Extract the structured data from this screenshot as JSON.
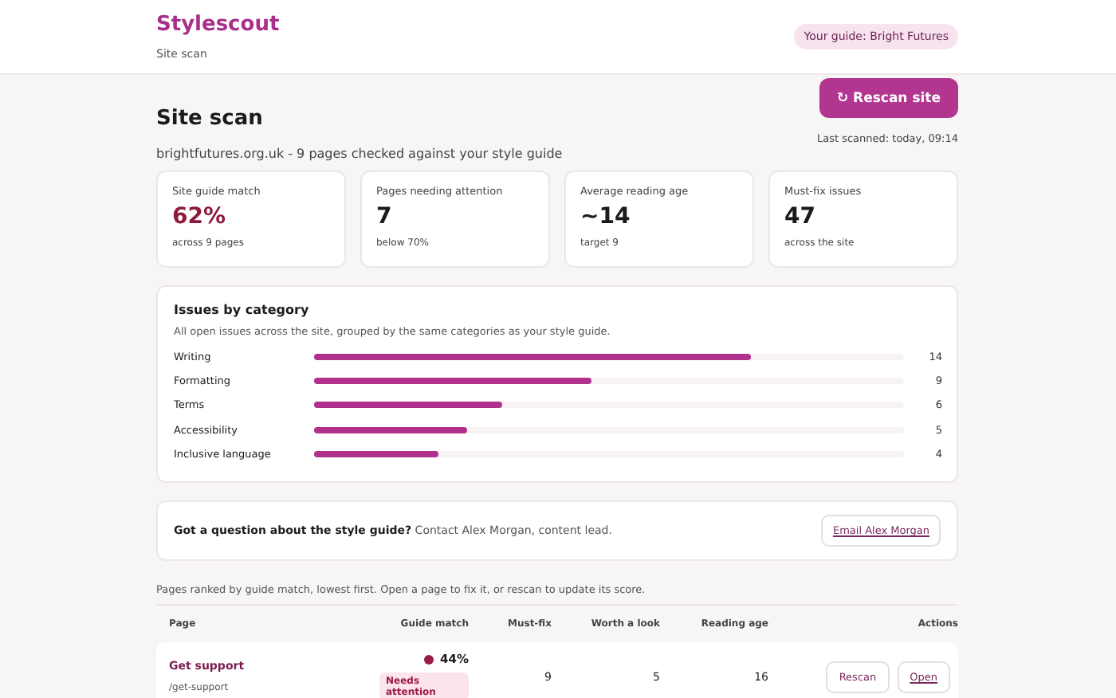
{
  "app": {
    "name": "Stylescout",
    "subtitle": "Site scan",
    "guide_badge": "Your guide: Bright Futures"
  },
  "page": {
    "title": "Site scan",
    "description": "brightfutures.org.uk - 9 pages checked against your style guide",
    "rescan_button": "↻ Rescan site",
    "last_scanned": "Last scanned: today, 09:14"
  },
  "stats": [
    {
      "label": "Site guide match",
      "value": "62%",
      "note": "across 9 pages",
      "kind": "alert"
    },
    {
      "label": "Pages needing attention",
      "value": "7",
      "note": "below 70%",
      "kind": "plain"
    },
    {
      "label": "Average reading age",
      "value": "~14",
      "note": "target 9",
      "kind": "plain"
    },
    {
      "label": "Must-fix issues",
      "value": "47",
      "note": "across the site",
      "kind": "plain"
    }
  ],
  "issues": {
    "title": "Issues by category",
    "description": "All open issues across the site, grouped by the same categories as your style guide.",
    "categories": [
      {
        "name": "Writing",
        "level": 0.74,
        "count": "14"
      },
      {
        "name": "Formatting",
        "level": 0.47,
        "count": "9"
      },
      {
        "name": "Terms",
        "level": 0.32,
        "count": "6"
      },
      {
        "name": "Accessibility",
        "level": 0.26,
        "count": "5"
      },
      {
        "name": "Inclusive language",
        "level": 0.21,
        "count": "4"
      }
    ]
  },
  "contact": {
    "text": "**Got a question about the style guide?** Contact Alex Morgan, content lead.",
    "button": "Email Alex Morgan"
  },
  "table": {
    "caption": "Pages ranked by guide match, lowest first. Open a page to fix it, or rescan to update its score.",
    "columns": [
      "Page",
      "Guide match",
      "Must-fix",
      "Worth a look",
      "Reading age",
      "Actions"
    ],
    "rows": [
      {
        "title": "Get support",
        "path": "/get-support",
        "match": "44%",
        "color": "#9b1b45",
        "status": "Needs attention",
        "must_fix": "9",
        "worth_a_look": "5",
        "reading_age": "16",
        "actions": [
          "Rescan",
          "Open"
        ]
      }
    ]
  }
}
